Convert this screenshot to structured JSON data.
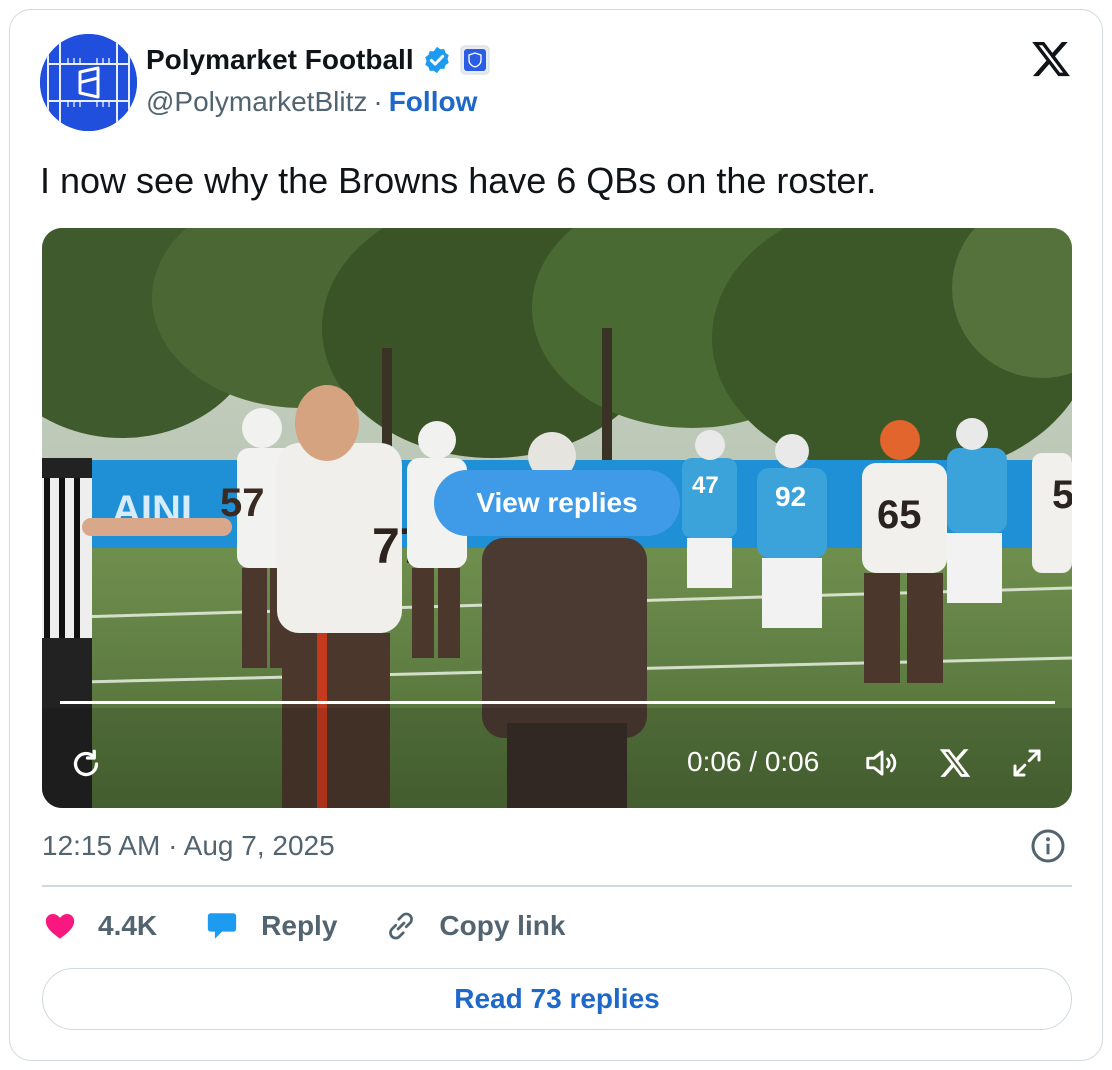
{
  "author": {
    "name": "Polymarket Football",
    "handle": "@PolymarketBlitz",
    "separator": "·",
    "follow_label": "Follow",
    "verified_color": "#1d9bf0"
  },
  "tweet": {
    "text": "I now see why the Browns have 6 QBs on the roster."
  },
  "media": {
    "view_replies_label": "View replies",
    "time_display": "0:06 / 0:06",
    "progress": 1.0,
    "jersey_numbers": [
      "57",
      "77",
      "47",
      "92",
      "65",
      "5"
    ],
    "banner_text": "AINI"
  },
  "meta": {
    "timestamp": "12:15 AM · Aug 7, 2025"
  },
  "actions": {
    "like_count": "4.4K",
    "reply_label": "Reply",
    "copy_link_label": "Copy link",
    "read_replies_label": "Read 73 replies"
  },
  "colors": {
    "accent_blue": "#1d68c9",
    "like_pink": "#f91880",
    "reply_blue": "#1d9bf0"
  }
}
